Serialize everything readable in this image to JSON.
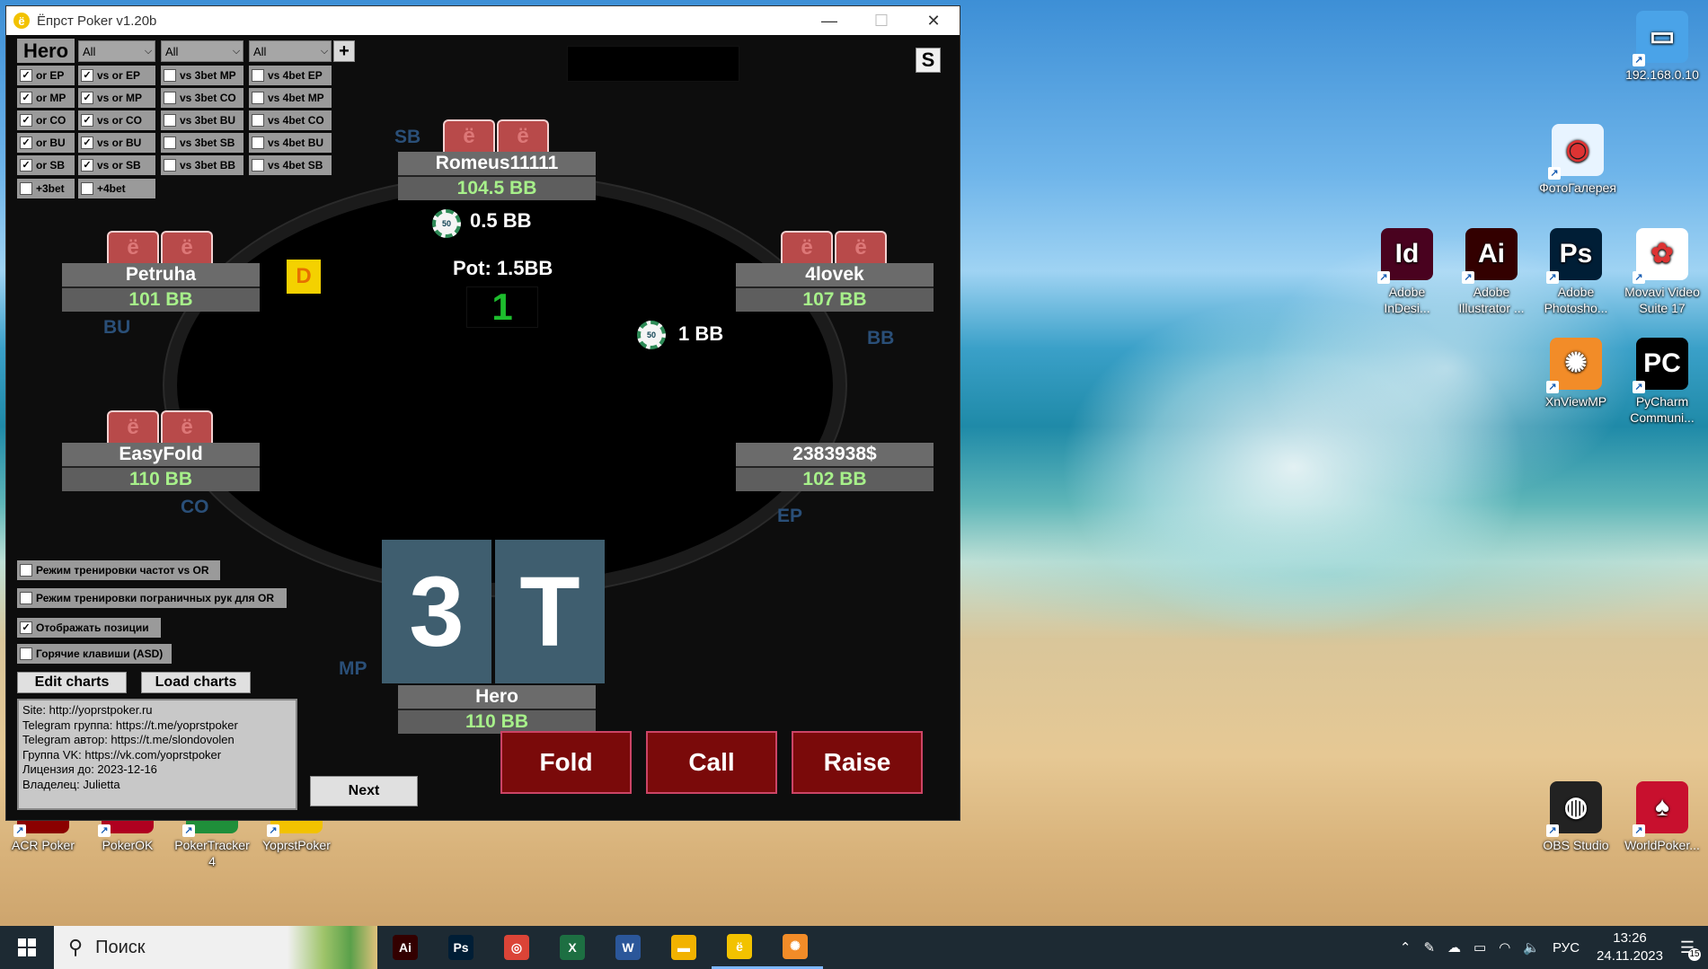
{
  "window": {
    "title": "Ёпрст Poker v1.20b",
    "minimize": "—",
    "maximize": "☐",
    "close": "✕"
  },
  "filters": {
    "hero_label": "Hero",
    "selects": [
      "All",
      "All",
      "All"
    ],
    "plus": "+",
    "s_button": "S"
  },
  "checkbox_cols": [
    [
      {
        "label": "or EP",
        "checked": true
      },
      {
        "label": "or MP",
        "checked": true
      },
      {
        "label": "or CO",
        "checked": true
      },
      {
        "label": "or BU",
        "checked": true
      },
      {
        "label": "or SB",
        "checked": true
      }
    ],
    [
      {
        "label": "vs or EP",
        "checked": true
      },
      {
        "label": "vs or MP",
        "checked": true
      },
      {
        "label": "vs or CO",
        "checked": true
      },
      {
        "label": "vs or BU",
        "checked": true
      },
      {
        "label": "vs or SB",
        "checked": true
      }
    ],
    [
      {
        "label": "vs 3bet MP",
        "checked": false
      },
      {
        "label": "vs 3bet CO",
        "checked": false
      },
      {
        "label": "vs 3bet BU",
        "checked": false
      },
      {
        "label": "vs 3bet SB",
        "checked": false
      },
      {
        "label": "vs 3bet BB",
        "checked": false
      }
    ],
    [
      {
        "label": "vs 4bet EP",
        "checked": false
      },
      {
        "label": "vs 4bet MP",
        "checked": false
      },
      {
        "label": "vs 4bet CO",
        "checked": false
      },
      {
        "label": "vs 4bet BU",
        "checked": false
      },
      {
        "label": "vs 4bet SB",
        "checked": false
      }
    ]
  ],
  "extra_checks": [
    {
      "label": "+3bet",
      "checked": false
    },
    {
      "label": "+4bet",
      "checked": false
    }
  ],
  "seats": {
    "sb": {
      "name": "Romeus11111",
      "stack": "104.5 BB",
      "pos": "SB",
      "bet": "0.5 BB"
    },
    "bu": {
      "name": "Petruha",
      "stack": "101 BB",
      "pos": "BU"
    },
    "bb": {
      "name": "4lovek",
      "stack": "107 BB",
      "pos": "BB",
      "bet": "1 BB"
    },
    "co": {
      "name": "EasyFold",
      "stack": "110 BB",
      "pos": "CO"
    },
    "ep": {
      "name": "2383938$",
      "stack": "102 BB",
      "pos": "EP"
    },
    "hero": {
      "name": "Hero",
      "stack": "110 BB",
      "pos": "MP",
      "cards": [
        "3",
        "T"
      ]
    }
  },
  "chip_label": "50",
  "dealer": "D",
  "pot": "Pot: 1.5BB",
  "counter": "1",
  "options": [
    {
      "label": "Режим тренировки частот vs OR",
      "checked": false
    },
    {
      "label": "Режим тренировки пограничных рук для OR",
      "checked": false
    },
    {
      "label": "Отображать позиции",
      "checked": true
    },
    {
      "label": "Горячие клавиши (ASD)",
      "checked": false
    }
  ],
  "buttons": {
    "edit_charts": "Edit charts",
    "load_charts": "Load charts",
    "next": "Next",
    "fold": "Fold",
    "call": "Call",
    "raise": "Raise"
  },
  "info_lines": [
    "Site: http://yoprstpoker.ru",
    "Telegram группа: https://t.me/yoprstpoker",
    "Telegram автор: https://t.me/slondovolen",
    "Группа VK: https://vk.com/yoprstpoker",
    "Лицензия до: 2023-12-16",
    "Владелец: Julietta"
  ],
  "desktop_icons": [
    {
      "label": "192.168.0.10",
      "icon": "monitor-icon",
      "color": "#4aa3e8",
      "glyph": "▭"
    },
    {
      "label": "ФотоГалерея",
      "icon": "photo-gallery-icon",
      "color": "#e8f4ff",
      "glyph": "◉"
    },
    {
      "label": "Adobe InDesi...",
      "icon": "indesign-icon",
      "color": "#49021f",
      "glyph": "Id"
    },
    {
      "label": "Adobe Illustrator ...",
      "icon": "illustrator-icon",
      "color": "#330000",
      "glyph": "Ai"
    },
    {
      "label": "Adobe Photosho...",
      "icon": "photoshop-icon",
      "color": "#001e36",
      "glyph": "Ps"
    },
    {
      "label": "Movavi Video Suite 17",
      "icon": "movavi-icon",
      "color": "#ffffff",
      "glyph": "✿"
    },
    {
      "label": "XnViewMP",
      "icon": "xnview-icon",
      "color": "#f28c28",
      "glyph": "✺"
    },
    {
      "label": "PyCharm Communi...",
      "icon": "pycharm-icon",
      "color": "#000000",
      "glyph": "PC"
    },
    {
      "label": "OBS Studio",
      "icon": "obs-icon",
      "color": "#222222",
      "glyph": "◍"
    },
    {
      "label": "WorldPoker...",
      "icon": "worldpoker-icon",
      "color": "#c8102e",
      "glyph": "♠"
    },
    {
      "label": "ACR Poker",
      "icon": "acr-poker-icon",
      "color": "#8b0000",
      "glyph": "♣"
    },
    {
      "label": "PokerOK",
      "icon": "pokerok-icon",
      "color": "#b00020",
      "glyph": "♥"
    },
    {
      "label": "PokerTracker 4",
      "icon": "pokertracker-icon",
      "color": "#1f8f3a",
      "glyph": "♦"
    },
    {
      "label": "YoprstPoker",
      "icon": "yoprst-icon",
      "color": "#f2c200",
      "glyph": "ё"
    }
  ],
  "taskbar": {
    "search_placeholder": "Поиск",
    "apps": [
      {
        "icon": "illustrator-icon",
        "glyph": "Ai",
        "color": "#330000"
      },
      {
        "icon": "photoshop-icon",
        "glyph": "Ps",
        "color": "#001e36"
      },
      {
        "icon": "chrome-icon",
        "glyph": "◎",
        "color": "#db4437"
      },
      {
        "icon": "excel-icon",
        "glyph": "X",
        "color": "#1d6f42"
      },
      {
        "icon": "word-icon",
        "glyph": "W",
        "color": "#2b579a"
      },
      {
        "icon": "explorer-icon",
        "glyph": "▬",
        "color": "#f2b200"
      },
      {
        "icon": "yoprst-icon",
        "glyph": "ё",
        "color": "#f2c200"
      },
      {
        "icon": "xnview-icon",
        "glyph": "✺",
        "color": "#f28c28"
      }
    ],
    "language": "РУС",
    "time": "13:26",
    "date": "24.11.2023",
    "notifications": "15"
  }
}
